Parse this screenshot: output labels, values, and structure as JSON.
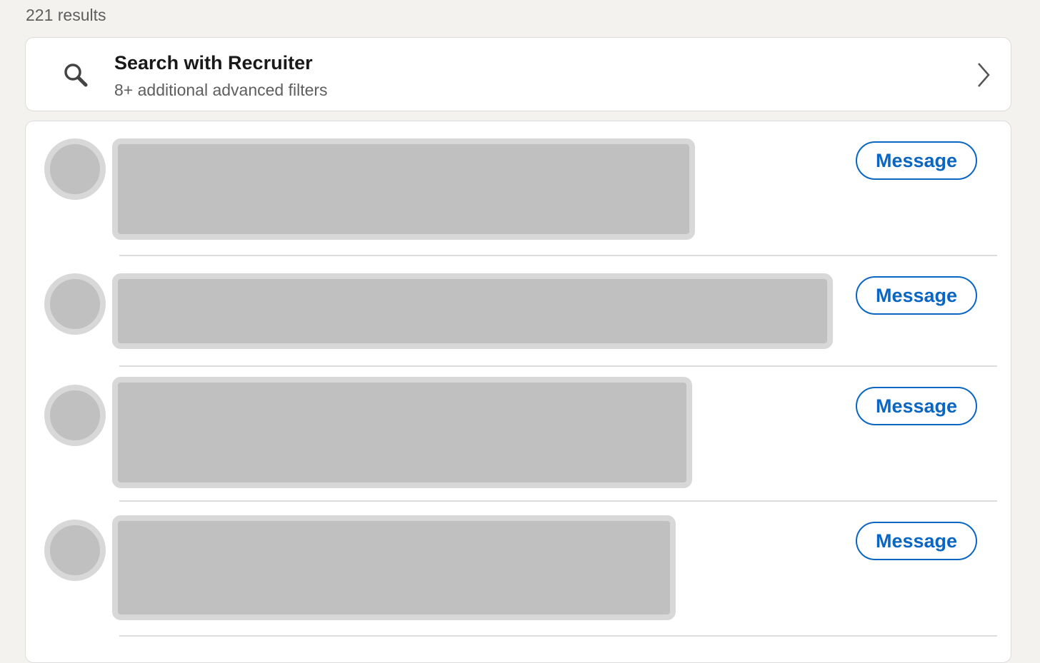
{
  "results": {
    "count_text": "221 results"
  },
  "recruiter_promo": {
    "title": "Search with Recruiter",
    "subtitle": "8+ additional advanced filters",
    "icon": "search-icon",
    "chevron": "chevron-right-icon"
  },
  "people": [
    {
      "button_label": "Message"
    },
    {
      "button_label": "Message"
    },
    {
      "button_label": "Message"
    },
    {
      "button_label": "Message"
    }
  ],
  "colors": {
    "accent": "#0a66c2",
    "background": "#f3f2ef",
    "placeholder": "#c0c0c0"
  }
}
